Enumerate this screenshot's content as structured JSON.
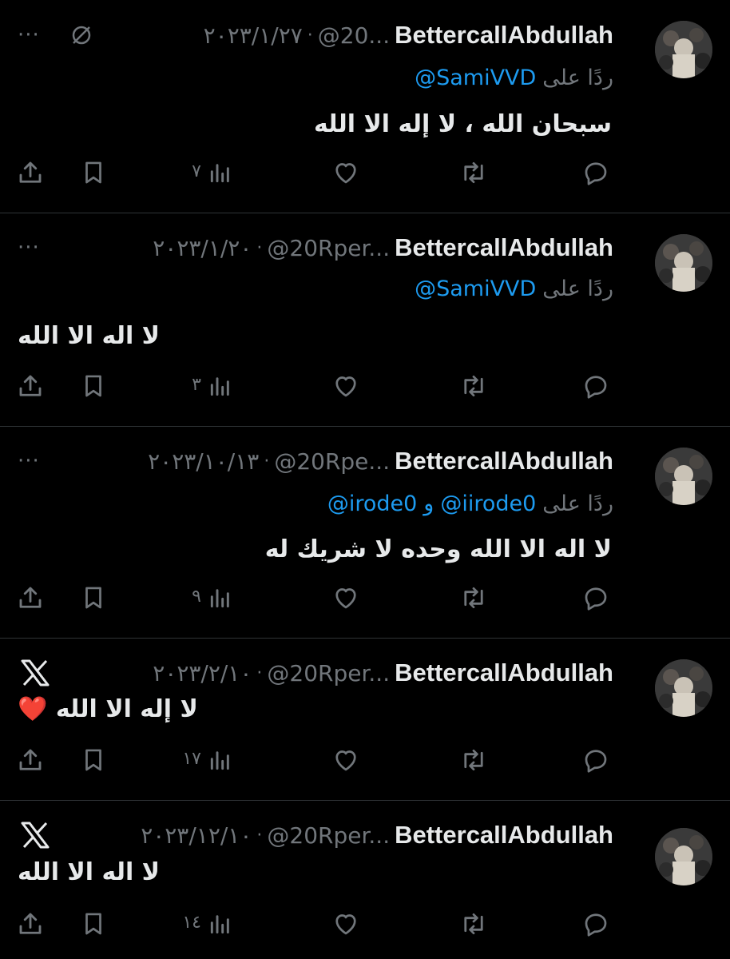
{
  "tweets": [
    {
      "author": "BettercallAbdullah",
      "handle": "@20...",
      "date": "٢٠٢٣/١/٢٧",
      "reply_prefix": "ردًا على",
      "mentions": [
        "@SamiVVD"
      ],
      "text": "سبحان الله ، لا إله الا الله",
      "views": "٧",
      "side_icon": "hidden-slash-icon"
    },
    {
      "author": "BettercallAbdullah",
      "handle": "@20Rper...",
      "date": "٢٠٢٣/١/٢٠",
      "reply_prefix": "ردًا على",
      "mentions": [
        "@SamiVVD"
      ],
      "text": "لا اله الا الله",
      "views": "٣",
      "side_icon": ""
    },
    {
      "author": "BettercallAbdullah",
      "handle": "@20Rpe...",
      "date": "٢٠٢٣/١٠/١٣",
      "reply_prefix": "ردًا على",
      "mentions": [
        "@iirode0",
        "@irode0"
      ],
      "conjunction": "و",
      "text": "لا اله الا الله وحده لا شريك له",
      "views": "٩",
      "side_icon": ""
    },
    {
      "author": "BettercallAbdullah",
      "handle": "@20Rper...",
      "date": "٢٠٢٣/٢/١٠",
      "text": "لا إله الا الله",
      "emoji": "❤️",
      "views": "١٧",
      "side_icon": "x-logo-icon"
    },
    {
      "author": "BettercallAbdullah",
      "handle": "@20Rper...",
      "date": "٢٠٢٣/١٢/١٠",
      "text": "لا اله الا الله",
      "views": "١٤",
      "side_icon": "x-logo-icon"
    }
  ],
  "ui": {
    "separator": "·",
    "more": "···"
  },
  "colors": {
    "background": "#000000",
    "text": "#e7e9ea",
    "muted": "#71767b",
    "link": "#1d9bf0",
    "divider": "#2f3336"
  }
}
